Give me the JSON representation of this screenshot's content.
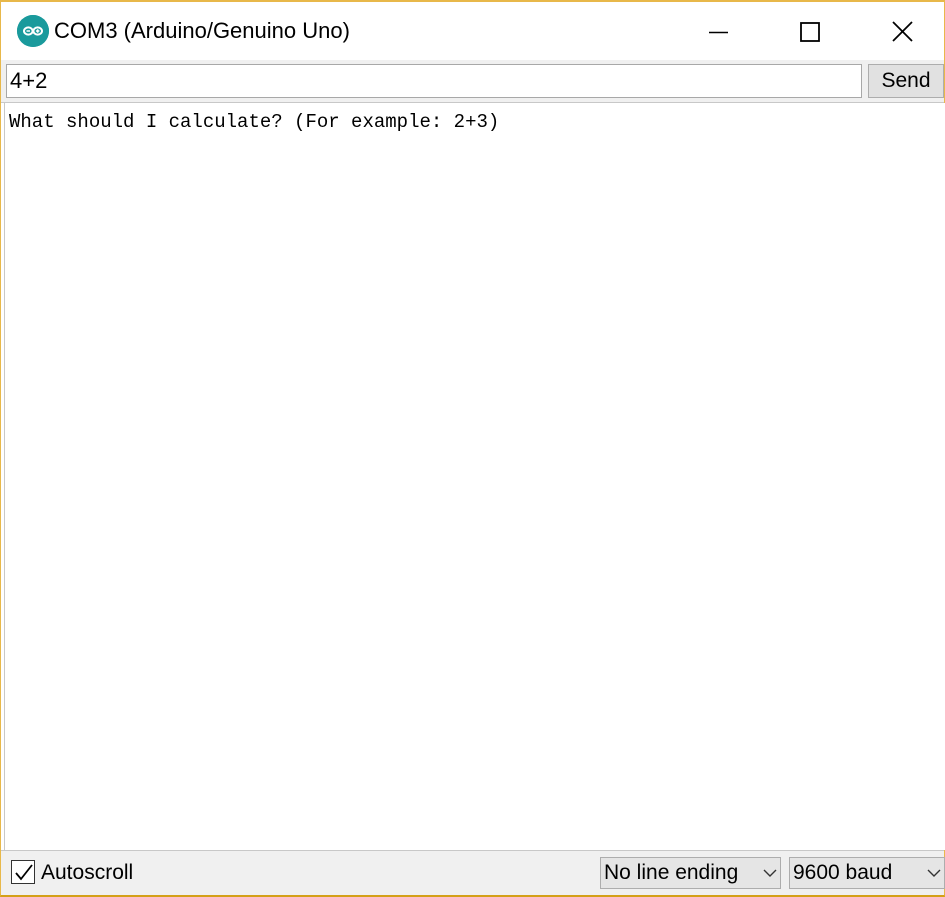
{
  "window": {
    "title": "COM3 (Arduino/Genuino Uno)",
    "border_color": "#e8b84a",
    "app_icon": "arduino-icon",
    "controls": {
      "minimize_icon": "minimize-icon",
      "maximize_icon": "maximize-icon",
      "close_icon": "close-icon"
    }
  },
  "input": {
    "value": "4+2",
    "send_label": "Send"
  },
  "output": {
    "lines": [
      "What should I calculate? (For example: 2+3)"
    ]
  },
  "footer": {
    "autoscroll_label": "Autoscroll",
    "autoscroll_checked": true,
    "line_ending_selected": "No line ending",
    "baud_selected": "9600 baud"
  },
  "colors": {
    "accent": "#1a9a9c"
  }
}
